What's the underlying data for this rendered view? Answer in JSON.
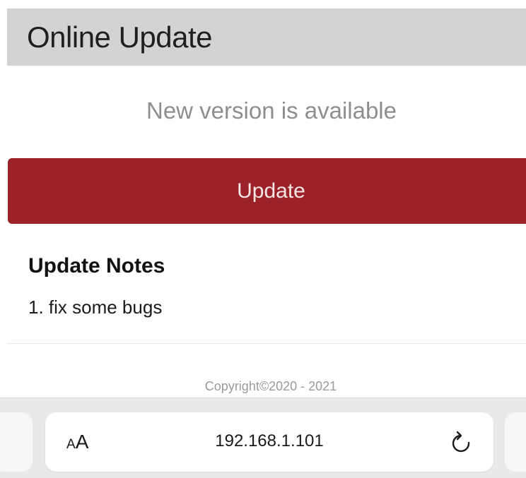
{
  "header": {
    "title": "Online Update"
  },
  "status": {
    "message": "New version is available"
  },
  "actions": {
    "update_label": "Update"
  },
  "notes": {
    "heading": "Update Notes",
    "items": [
      "1. fix some bugs"
    ]
  },
  "footer": {
    "copyright": "Copyright©2020 - 2021"
  },
  "browser": {
    "text_size_small": "A",
    "text_size_large": "A",
    "url": "192.168.1.101",
    "reload_icon": "reload-icon"
  },
  "colors": {
    "header_bg": "#d3d3d3",
    "button_bg": "#9b2229",
    "button_text": "#f6e6e6",
    "status_text": "#8e8e8e"
  }
}
